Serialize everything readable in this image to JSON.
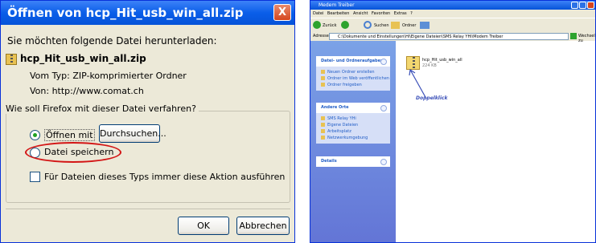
{
  "dialog": {
    "title": "Öffnen von hcp_Hit_usb_win_all.zip",
    "close": "X",
    "prompt": "Sie möchten folgende Datei herunterladen:",
    "filename": "hcp_Hit_usb_win_all.zip",
    "type_line": "Vom Typ:  ZIP-komprimierter Ordner",
    "from_line": "Von:  http://www.comat.ch",
    "group_label": "Wie soll Firefox mit dieser Datei verfahren?",
    "open_with": "Öffnen mit",
    "browse": "Durchsuchen...",
    "save_file": "Datei speichern",
    "always": "Für Dateien dieses Typs immer diese Aktion ausführen",
    "ok": "OK",
    "cancel": "Abbrechen"
  },
  "explorer": {
    "title": "Medem Treiber",
    "menu": "Datei  Bearbeiten  Ansicht  Favoriten  Extras  ?",
    "back": "Zurück",
    "search": "Suchen",
    "folders": "Ordner",
    "address_label": "Adresse",
    "address": "C:\\Dokumente und Einstellungen\\Hi\\Eigene Dateien\\SMS Relay YHi\\Modem Treiber",
    "go": "Wechseln zu",
    "tasks_title": "Datei- und Ordneraufgaben",
    "tasks": [
      "Neuen Ordner erstellen",
      "Ordner im Web veröffentlichen",
      "Ordner freigeben"
    ],
    "places_title": "Andere Orte",
    "places": [
      "SMS Relay YHi",
      "Eigene Dateien",
      "Arbeitsplatz",
      "Netzwerkumgebung"
    ],
    "details_title": "Details",
    "file_name": "hcp_Hit_usb_win_all",
    "file_size": "224 KB",
    "annotation": "Doppelklick"
  },
  "colors": {
    "annotation": "#3a4fb8",
    "highlight": "#d31515"
  }
}
